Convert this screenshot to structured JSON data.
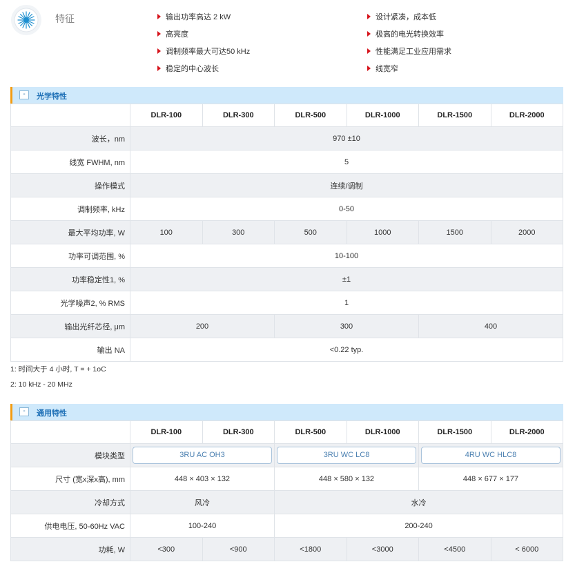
{
  "features": {
    "title": "特征",
    "col1": [
      "输出功率高达 2 kW",
      "高亮度",
      "调制频率最大可达50 kHz",
      "稳定的中心波长"
    ],
    "col2": [
      "设计紧凑，成本低",
      "极高的电光转换效率",
      "性能满足工业应用需求",
      "线宽窄"
    ]
  },
  "optical": {
    "section_title": "光学特性",
    "toggle": "-",
    "models": [
      "DLR-100",
      "DLR-300",
      "DLR-500",
      "DLR-1000",
      "DLR-1500",
      "DLR-2000"
    ],
    "rows": {
      "wavelength": {
        "label": "波长，nm",
        "value": "970 ±10"
      },
      "linewidth": {
        "label": "线宽 FWHM, nm",
        "value": "5"
      },
      "mode": {
        "label": "操作模式",
        "value": "连续/调制"
      },
      "modfreq": {
        "label": "调制频率, kHz",
        "value": "0-50"
      },
      "power": {
        "label": "最大平均功率, W",
        "values": [
          "100",
          "300",
          "500",
          "1000",
          "1500",
          "2000"
        ]
      },
      "adjust": {
        "label": "功率可调范围, %",
        "value": "10-100"
      },
      "stability": {
        "label": "功率稳定性1, %",
        "value": "±1"
      },
      "noise": {
        "label": "光学噪声2, % RMS",
        "value": "1"
      },
      "fiber": {
        "label": "输出光纤芯径, μm",
        "values": [
          "200",
          "300",
          "400"
        ]
      },
      "na": {
        "label": "输出 NA",
        "value": "<0.22 typ."
      }
    },
    "notes": [
      "1: 时间大于 4 小时, T = + 1oC",
      "2: 10 kHz - 20 MHz"
    ]
  },
  "general": {
    "section_title": "通用特性",
    "toggle": "-",
    "models": [
      "DLR-100",
      "DLR-300",
      "DLR-500",
      "DLR-1000",
      "DLR-1500",
      "DLR-2000"
    ],
    "rows": {
      "module": {
        "label": "模块类型",
        "values": [
          "3RU AC OH3",
          "3RU WC LC8",
          "4RU WC HLC8"
        ]
      },
      "size": {
        "label": "尺寸 (宽x深x高), mm",
        "values": [
          "448 × 403 × 132",
          "448 × 580 × 132",
          "448 × 677 × 177"
        ]
      },
      "cooling": {
        "label": "冷却方式",
        "values": [
          "风冷",
          "水冷"
        ]
      },
      "voltage": {
        "label": "供电电压, 50-60Hz VAC",
        "values": [
          "100-240",
          "200-240"
        ]
      },
      "consumption": {
        "label": "功耗, W",
        "values": [
          "<300",
          "<900",
          "<1800",
          "<3000",
          "<4500",
          "< 6000"
        ]
      }
    }
  },
  "colors": {
    "accent": "#1d6fb6",
    "bullet": "#d6131b",
    "section_bg": "#cfe9fb",
    "row_alt": "#eef0f3",
    "section_edge": "#f39c12"
  }
}
